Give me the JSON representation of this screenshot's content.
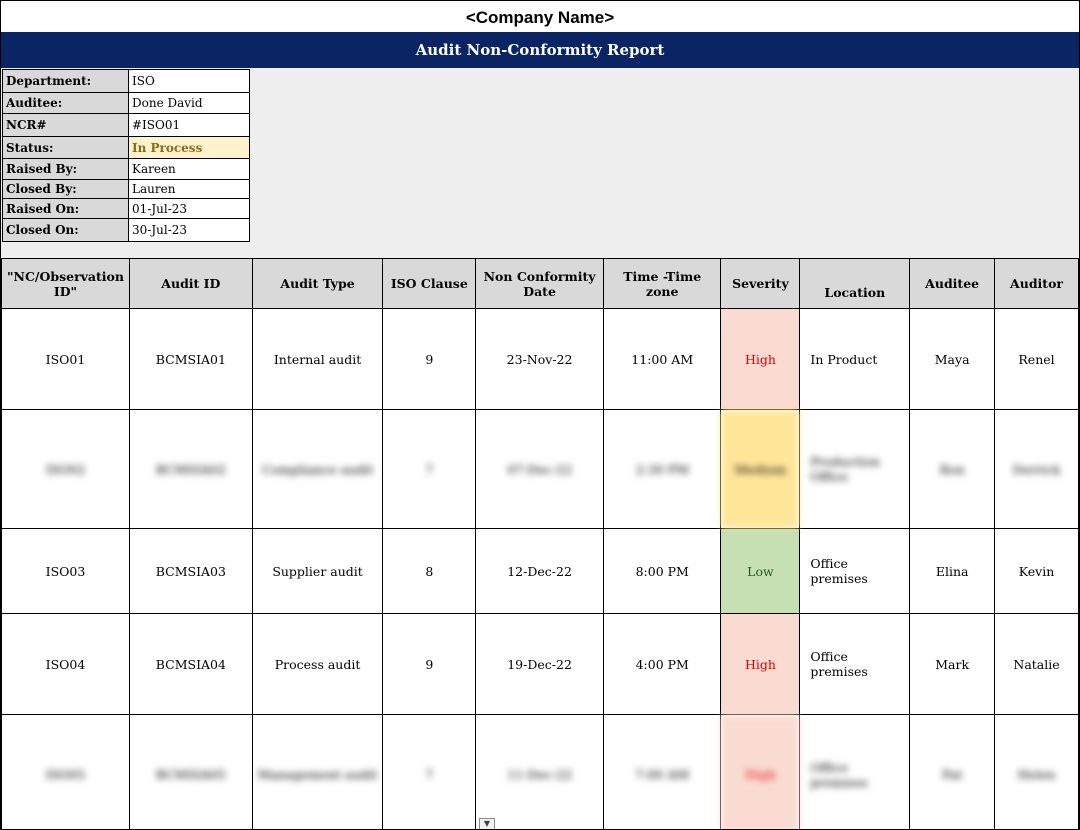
{
  "company_name": "<Company Name>",
  "report_title": "Audit Non-Conformity Report",
  "info": {
    "department_label": "Department:",
    "department_value": "ISO",
    "auditee_label": "Auditee:",
    "auditee_value": "Done David",
    "ncr_label": "NCR#",
    "ncr_value": "#ISO01",
    "status_label": "Status:",
    "status_value": "In Process",
    "raised_by_label": "Raised By:",
    "raised_by_value": "Kareen",
    "closed_by_label": "Closed By:",
    "closed_by_value": "Lauren",
    "raised_on_label": "Raised On:",
    "raised_on_value": "01-Jul-23",
    "closed_on_label": "Closed On:",
    "closed_on_value": "30-Jul-23"
  },
  "table": {
    "headers": [
      "\"NC/Observation ID\"",
      "Audit ID",
      "Audit Type",
      "ISO Clause",
      "Non Conformity Date",
      "Time -Time zone",
      "Severity",
      "Location",
      "Auditee",
      "Auditor"
    ],
    "rows": [
      {
        "id": "ISO01",
        "audit_id": "BCMSIA01",
        "audit_type": "Internal audit",
        "clause": "9",
        "date": "23-Nov-22",
        "time": "11:00 AM",
        "severity": "High",
        "location": "In Product",
        "auditee": "Maya",
        "auditor": "Renel"
      },
      {
        "id": "ISO02",
        "audit_id": "BCMSIA02",
        "audit_type": "Compliance audit",
        "clause": "7",
        "date": "07-Dec-22",
        "time": "2:30 PM",
        "severity": "Medium",
        "location": "Production Office",
        "auditee": "Ron",
        "auditor": "Derrick"
      },
      {
        "id": "ISO03",
        "audit_id": "BCMSIA03",
        "audit_type": "Supplier audit",
        "clause": "8",
        "date": "12-Dec-22",
        "time": "8:00 PM",
        "severity": "Low",
        "location": "Office premises",
        "auditee": "Elina",
        "auditor": "Kevin"
      },
      {
        "id": "ISO04",
        "audit_id": "BCMSIA04",
        "audit_type": "Process audit",
        "clause": "9",
        "date": "19-Dec-22",
        "time": "4:00 PM",
        "severity": "High",
        "location": "Office premises",
        "auditee": "Mark",
        "auditor": "Natalie"
      },
      {
        "id": "ISO05",
        "audit_id": "BCMSIA05",
        "audit_type": "Management audit",
        "clause": "7",
        "date": "11-Dec-22",
        "time": "7:00 AM",
        "severity": "High",
        "location": "Office premises",
        "auditee": "Pat",
        "auditor": "Helen"
      }
    ]
  },
  "colors": {
    "banner": "#0b2463",
    "header_fill": "#d9d9d9",
    "status_fill": "#fff2cc",
    "severity_high": "#fadbd2",
    "severity_medium": "#ffe699",
    "severity_low": "#c6e0b4"
  },
  "icons": {
    "dropdown": "dropdown-arrow-icon"
  }
}
